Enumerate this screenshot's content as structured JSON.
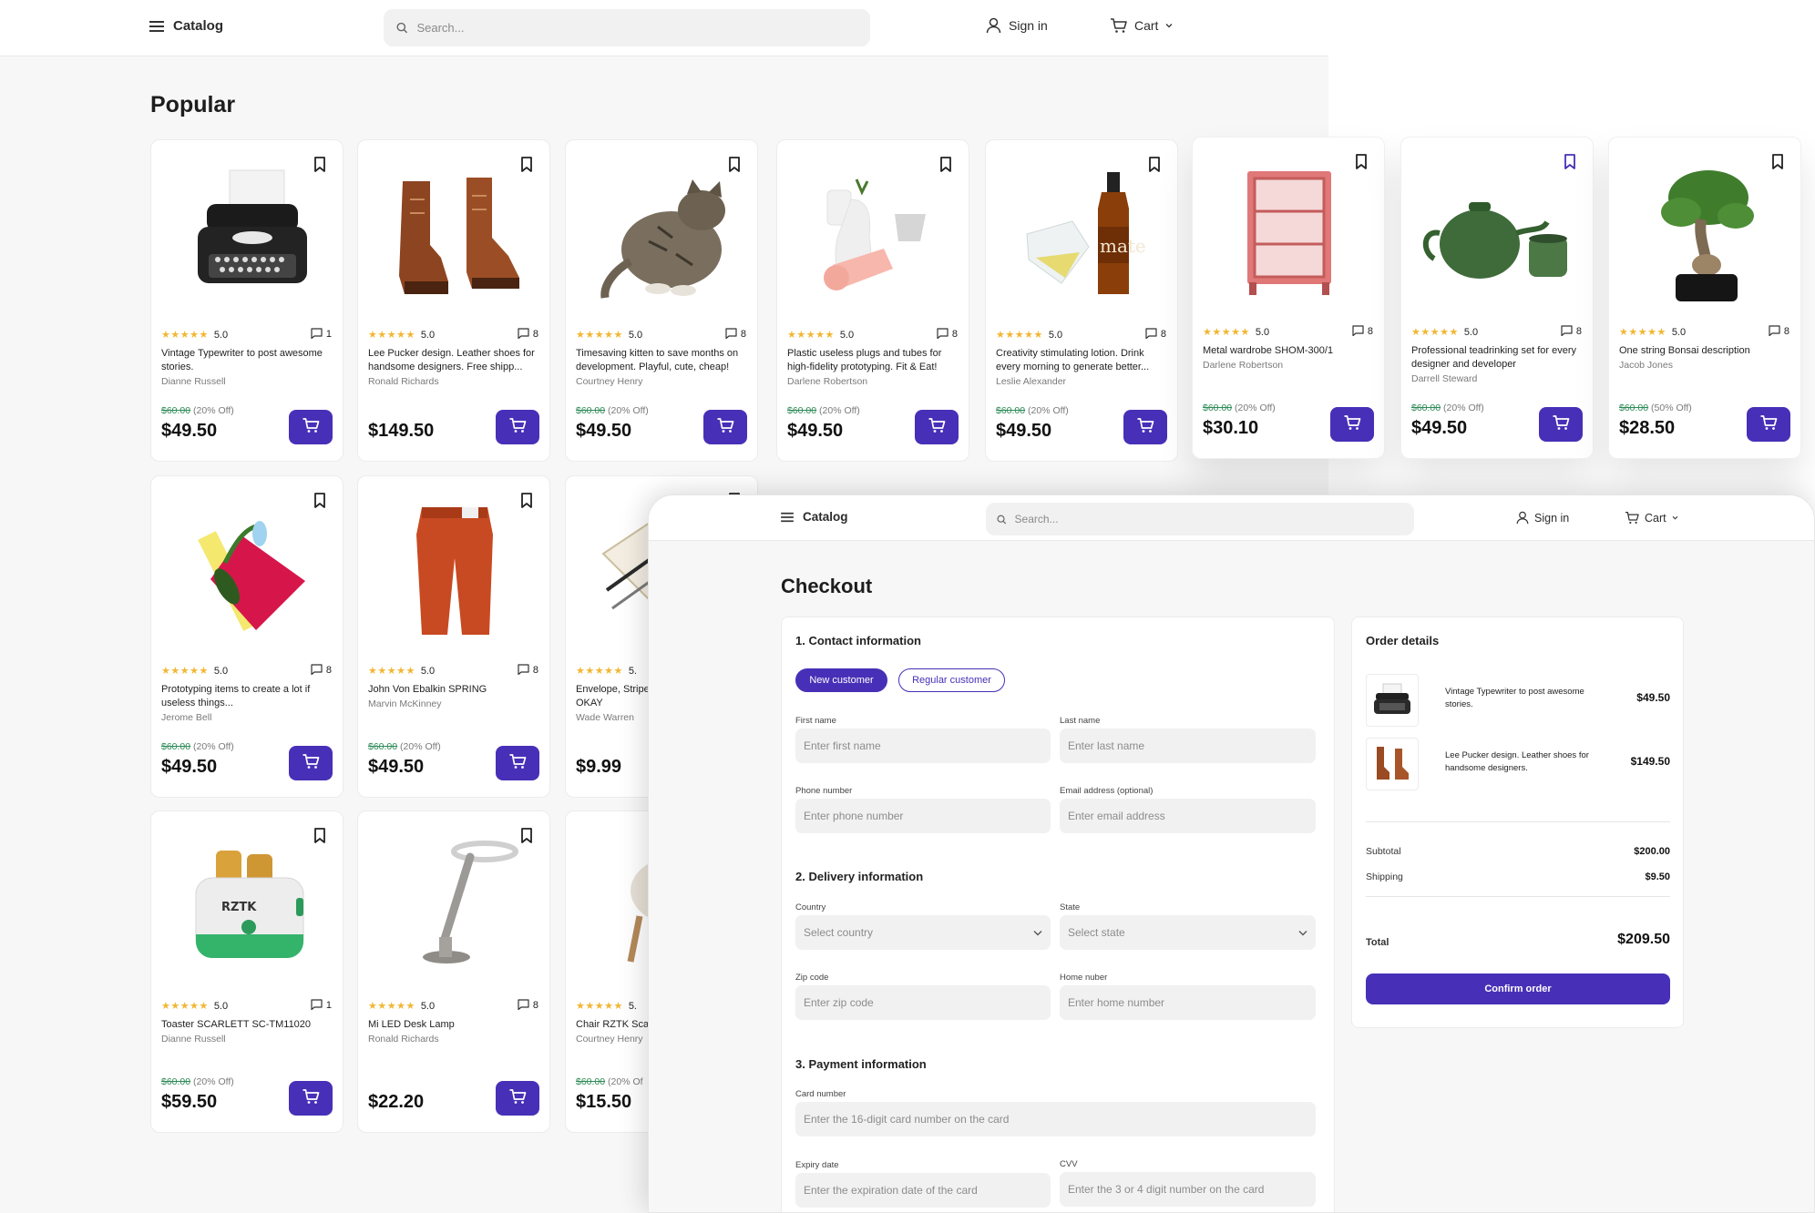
{
  "catalog": {
    "header": {
      "menu_label": "Catalog",
      "search_placeholder": "Search...",
      "sign_in": "Sign in",
      "cart": "Cart"
    },
    "section_title": "Popular",
    "products": [
      {
        "stars": "★★★★★",
        "rating": "5.0",
        "comments": "1",
        "title": "Vintage Typewriter to post awesome stories.",
        "author": "Dianne Russell",
        "old_price": "$60.00",
        "discount": "(20% Off)",
        "price": "$49.50",
        "image_icon": "typewriter-image"
      },
      {
        "stars": "★★★★★",
        "rating": "5.0",
        "comments": "8",
        "title": "Lee Pucker design. Leather shoes for handsome designers. Free shipp...",
        "author": "Ronald Richards",
        "old_price": "",
        "discount": "",
        "price": "$149.50",
        "image_icon": "leather-boots-image"
      },
      {
        "stars": "★★★★★",
        "rating": "5.0",
        "comments": "8",
        "title": "Timesaving kitten to save months on development. Playful, cute, cheap!",
        "author": "Courtney Henry",
        "old_price": "$60.00",
        "discount": "(20% Off)",
        "price": "$49.50",
        "image_icon": "kitten-image"
      },
      {
        "stars": "★★★★★",
        "rating": "5.0",
        "comments": "8",
        "title": "Plastic useless plugs and tubes for high-fidelity prototyping. Fit & Eat!",
        "author": "Darlene Robertson",
        "old_price": "$60.00",
        "discount": "(20% Off)",
        "price": "$49.50",
        "image_icon": "plastic-plugs-image"
      },
      {
        "stars": "★★★★★",
        "rating": "5.0",
        "comments": "8",
        "title": "Creativity stimulating lotion. Drink every morning to generate better...",
        "author": "Leslie Alexander",
        "old_price": "$60.00",
        "discount": "(20% Off)",
        "price": "$49.50",
        "image_icon": "mate-bottle-image"
      },
      {
        "stars": "★★★★★",
        "rating": "5.0",
        "comments": "8",
        "title": "Metal wardrobe SHOM-300/1",
        "author": "Darlene Robertson",
        "old_price": "$60.00",
        "discount": "(20% Off)",
        "price": "$30.10",
        "image_icon": "wardrobe-image"
      },
      {
        "stars": "★★★★★",
        "rating": "5.0",
        "comments": "8",
        "title": "Professional teadrinking set for every designer and developer",
        "author": "Darrell Steward",
        "old_price": "$60.00",
        "discount": "(20% Off)",
        "price": "$49.50",
        "image_icon": "teapot-image"
      },
      {
        "stars": "★★★★★",
        "rating": "5.0",
        "comments": "8",
        "title": "One string Bonsai description",
        "author": "Jacob Jones",
        "old_price": "$60.00",
        "discount": "(50% Off)",
        "price": "$28.50",
        "image_icon": "bonsai-image"
      },
      {
        "stars": "★★★★★",
        "rating": "5.0",
        "comments": "8",
        "title": "Prototyping items to create a lot if useless things...",
        "author": "Jerome Bell",
        "old_price": "$60.00",
        "discount": "(20% Off)",
        "price": "$49.50",
        "image_icon": "notebook-image"
      },
      {
        "stars": "★★★★★",
        "rating": "5.0",
        "comments": "8",
        "title": "John Von Ebalkin SPRING",
        "author": "Marvin McKinney",
        "old_price": "$60.00",
        "discount": "(20% Off)",
        "price": "$49.50",
        "image_icon": "pants-image"
      },
      {
        "stars": "★★★★★",
        "rating": "5.",
        "comments": "",
        "title": "Envelope, Stripe Purchase this k OKAY",
        "author": "Wade Warren",
        "old_price": "",
        "discount": "",
        "price": "$9.99",
        "image_icon": "envelope-image"
      },
      {
        "stars": "★★★★★",
        "rating": "5.0",
        "comments": "1",
        "title": "Toaster SCARLETT SC-TM11020",
        "author": "Dianne Russell",
        "old_price": "$60.00",
        "discount": "(20% Off)",
        "price": "$59.50",
        "image_icon": "toaster-image"
      },
      {
        "stars": "★★★★★",
        "rating": "5.0",
        "comments": "8",
        "title": "Mi LED Desk Lamp",
        "author": "Ronald Richards",
        "old_price": "",
        "discount": "",
        "price": "$22.20",
        "image_icon": "desk-lamp-image"
      },
      {
        "stars": "★★★★★",
        "rating": "5.",
        "comments": "",
        "title": "Chair RZTK Sca set",
        "author": "Courtney Henry",
        "old_price": "$60.00",
        "discount": "(20% Of",
        "price": "$15.50",
        "image_icon": "chair-image"
      }
    ]
  },
  "checkout": {
    "header": {
      "menu_label": "Catalog",
      "search_placeholder": "Search...",
      "sign_in": "Sign in",
      "cart": "Cart"
    },
    "title": "Checkout",
    "contact": {
      "heading": "1. Contact information",
      "new_customer": "New customer",
      "regular_customer": "Regular customer",
      "first_name_label": "First name",
      "first_name_placeholder": "Enter first name",
      "last_name_label": "Last name",
      "last_name_placeholder": "Enter last name",
      "phone_label": "Phone number",
      "phone_placeholder": "Enter phone number",
      "email_label": "Email address (optional)",
      "email_placeholder": "Enter email address"
    },
    "delivery": {
      "heading": "2. Delivery information",
      "country_label": "Country",
      "country_value": "Select country",
      "state_label": "State",
      "state_value": "Select state",
      "zip_label": "Zip code",
      "zip_placeholder": "Enter zip code",
      "home_label": "Home nuber",
      "home_placeholder": "Enter home number"
    },
    "payment": {
      "heading": "3. Payment information",
      "card_label": "Card number",
      "card_placeholder": "Enter the 16-digit card number on the card",
      "expiry_label": "Expiry date",
      "expiry_placeholder": "Enter the expiration date of the card",
      "cvv_label": "CVV",
      "cvv_placeholder": "Enter the 3 or 4 digit number on the card"
    },
    "order": {
      "heading": "Order details",
      "items": [
        {
          "name": "Vintage Typewriter to post awesome stories.",
          "price": "$49.50",
          "image_icon": "typewriter-image"
        },
        {
          "name": "Lee Pucker design. Leather shoes for handsome designers.",
          "price": "$149.50",
          "image_icon": "leather-boots-image"
        }
      ],
      "subtotal_label": "Subtotal",
      "subtotal": "$200.00",
      "shipping_label": "Shipping",
      "shipping": "$9.50",
      "total_label": "Total",
      "total": "$209.50",
      "confirm": "Confirm order"
    }
  },
  "colors": {
    "accent": "#4730b7",
    "star": "#f2b632",
    "old_price": "#2e8b57",
    "background": "#f7f7f7"
  }
}
